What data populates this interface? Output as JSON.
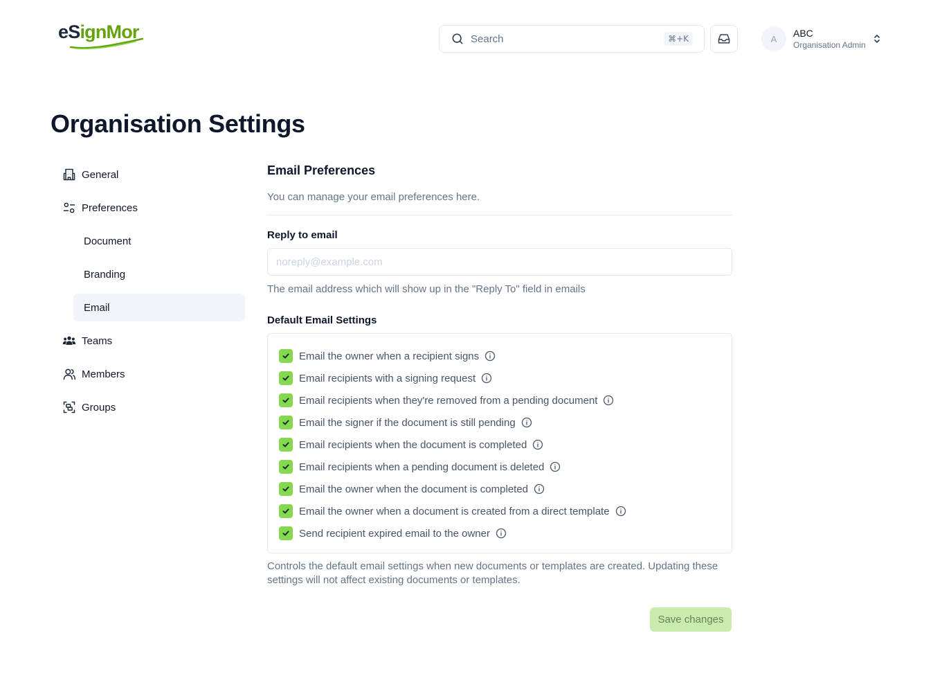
{
  "header": {
    "logo": {
      "part1": "eS",
      "part2": "ign",
      "part3": "Mor"
    },
    "search": {
      "label": "Search",
      "shortcut": "⌘+K"
    },
    "inbox_icon": "inbox-icon",
    "user": {
      "initial": "A",
      "name": "ABC",
      "role": "Organisation Admin"
    }
  },
  "page": {
    "title": "Organisation Settings"
  },
  "sidebar": {
    "items": [
      {
        "label": "General",
        "icon": "building-icon"
      },
      {
        "label": "Preferences",
        "icon": "settings-2-icon"
      },
      {
        "label": "Document"
      },
      {
        "label": "Branding"
      },
      {
        "label": "Email",
        "active": true
      },
      {
        "label": "Teams",
        "icon": "users-icon"
      },
      {
        "label": "Members",
        "icon": "user-icon"
      },
      {
        "label": "Groups",
        "icon": "group-icon"
      }
    ]
  },
  "main": {
    "title": "Email Preferences",
    "description": "You can manage your email preferences here.",
    "reply_to": {
      "label": "Reply to email",
      "placeholder": "noreply@example.com",
      "value": "",
      "helper": "The email address which will show up in the \"Reply To\" field in emails"
    },
    "default_settings": {
      "label": "Default Email Settings",
      "options": [
        {
          "label": "Email the owner when a recipient signs",
          "checked": true
        },
        {
          "label": "Email recipients with a signing request",
          "checked": true
        },
        {
          "label": "Email recipients when they're removed from a pending document",
          "checked": true
        },
        {
          "label": "Email the signer if the document is still pending",
          "checked": true
        },
        {
          "label": "Email recipients when the document is completed",
          "checked": true
        },
        {
          "label": "Email recipients when a pending document is deleted",
          "checked": true
        },
        {
          "label": "Email the owner when the document is completed",
          "checked": true
        },
        {
          "label": "Email the owner when a document is created from a direct template",
          "checked": true
        },
        {
          "label": "Send recipient expired email to the owner",
          "checked": true
        }
      ],
      "helper": "Controls the default email settings when new documents or templates are created. Updating these settings will not affect existing documents or templates."
    },
    "save_label": "Save changes"
  },
  "colors": {
    "accent": "#84d94e",
    "brand_green": "#65a30d",
    "text": "#0f172a",
    "muted": "#64748b"
  }
}
